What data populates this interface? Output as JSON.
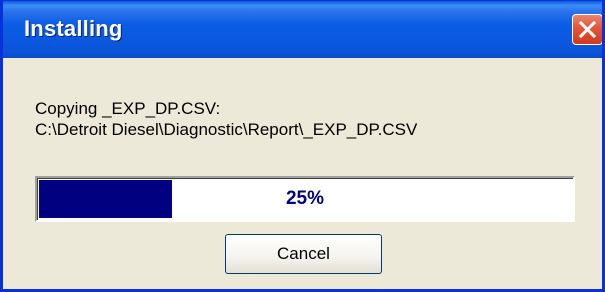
{
  "window": {
    "title": "Installing",
    "close_icon": "close-icon"
  },
  "message": {
    "line1": "Copying _EXP_DP.CSV:",
    "line2": "C:\\Detroit Diesel\\Diagnostic\\Report\\_EXP_DP.CSV"
  },
  "progress": {
    "value": 0.25,
    "label": "25%",
    "fill_color": "#000080"
  },
  "buttons": {
    "cancel_label": "Cancel"
  },
  "colors": {
    "titlebar": "#0a58de",
    "close_button": "#e0563b",
    "dialog_background": "#ece9d8"
  }
}
